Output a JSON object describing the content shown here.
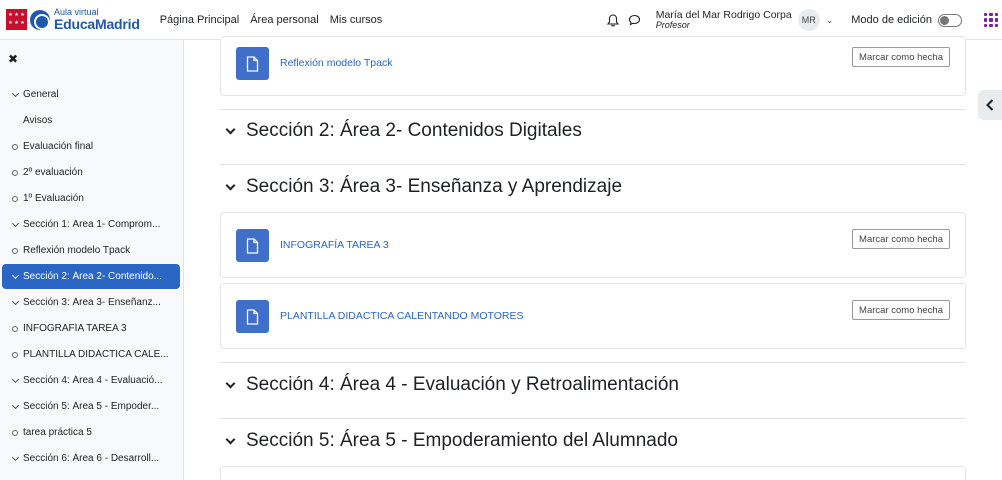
{
  "brand": {
    "small": "Aula virtual",
    "big": "EducaMadrid",
    "red": "#c8102e",
    "blue": "#1e5aa8"
  },
  "nav": {
    "links": [
      "Página Principal",
      "Área personal",
      "Mis cursos"
    ]
  },
  "user": {
    "name": "María del Mar Rodrigo Corpa",
    "role": "Profesor",
    "initials": "MR"
  },
  "edit_mode": {
    "label": "Modo de edición",
    "enabled": false
  },
  "sidebar": {
    "close_icon": "close-icon",
    "items": [
      {
        "type": "section",
        "label": "General"
      },
      {
        "type": "plain",
        "label": "Avisos"
      },
      {
        "type": "activity",
        "label": "Evaluación final"
      },
      {
        "type": "activity",
        "label": "2º evaluación"
      },
      {
        "type": "activity",
        "label": "1º Evaluación"
      },
      {
        "type": "section",
        "label": "Sección 1: Área 1- Comprom..."
      },
      {
        "type": "activity",
        "label": "Reflexión modelo Tpack"
      },
      {
        "type": "section",
        "label": "Sección 2: Área 2- Contenido...",
        "active": true
      },
      {
        "type": "section",
        "label": "Sección 3: Área 3- Enseñanz..."
      },
      {
        "type": "activity",
        "label": "INFOGRAFÍA TAREA 3"
      },
      {
        "type": "activity",
        "label": "PLANTILLA DIDACTICA CALE..."
      },
      {
        "type": "section",
        "label": "Sección 4: Área 4 - Evaluació..."
      },
      {
        "type": "section",
        "label": "Sección 5: Área 5 - Empoder..."
      },
      {
        "type": "activity",
        "label": "tarea práctica 5"
      },
      {
        "type": "section",
        "label": "Sección 6: Área 6 - Desarroll..."
      }
    ]
  },
  "main": {
    "mark_done_label": "Marcar como hecha",
    "resources": [
      {
        "title": "Reflexión modelo Tpack"
      },
      {
        "title": "INFOGRAFÍA TAREA 3"
      },
      {
        "title": "PLANTILLA DIDACTICA CALENTANDO MOTORES"
      }
    ],
    "sections": [
      {
        "title": "Sección 2: Área 2- Contenidos Digitales"
      },
      {
        "title": "Sección 3: Área 3- Enseñanza y Aprendizaje"
      },
      {
        "title": "Sección 4: Área 4 - Evaluación y Retroalimentación"
      },
      {
        "title": "Sección 5: Área 5 - Empoderamiento del Alumnado"
      }
    ]
  },
  "colors": {
    "accent": "#2b66c4",
    "resource_icon": "#3f6fc8",
    "apps": "#7a1fa2"
  }
}
